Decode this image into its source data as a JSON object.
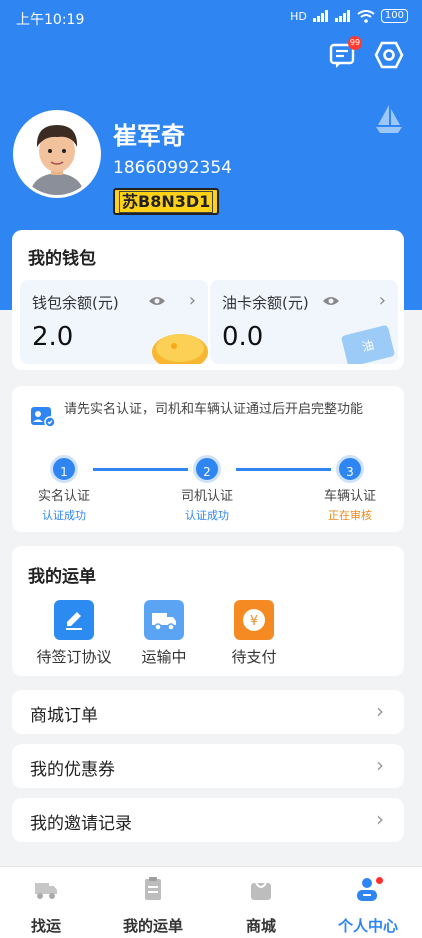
{
  "status_bar": {
    "time": "上午10:19",
    "network": "HD",
    "battery": "100"
  },
  "header": {
    "message_badge": "99"
  },
  "profile": {
    "name": "崔军奇",
    "phone": "18660992354",
    "plate": "苏B8N3D1"
  },
  "wallet": {
    "title": "我的钱包",
    "balance_label": "钱包余额(元)",
    "balance_value": "2.0",
    "oil_label": "油卡余额(元)",
    "oil_value": "0.0",
    "oil_card_text": "油"
  },
  "certification": {
    "notice": "请先实名认证，司机和车辆认证通过后开启完整功能",
    "steps": [
      {
        "number": "1",
        "label": "实名认证",
        "status": "认证成功"
      },
      {
        "number": "2",
        "label": "司机认证",
        "status": "认证成功"
      },
      {
        "number": "3",
        "label": "车辆认证",
        "status": "正在审核"
      }
    ],
    "colors": {
      "success": "#2f86f2",
      "pending": "#f08a18"
    }
  },
  "orders": {
    "title": "我的运单",
    "items": [
      {
        "label": "待签订协议",
        "icon": "pen-icon"
      },
      {
        "label": "运输中",
        "icon": "truck-icon"
      },
      {
        "label": "待支付",
        "icon": "yen-icon"
      }
    ]
  },
  "menu_rows": [
    {
      "label": "商城订单"
    },
    {
      "label": "我的优惠券"
    },
    {
      "label": "我的邀请记录"
    }
  ],
  "tabbar": {
    "tabs": [
      {
        "label": "找运",
        "icon": "truck-icon"
      },
      {
        "label": "我的运单",
        "icon": "clipboard-icon"
      },
      {
        "label": "商城",
        "icon": "shopping-bag-icon"
      },
      {
        "label": "个人中心",
        "icon": "person-icon",
        "active": true
      }
    ]
  },
  "theme": {
    "primary": "#2f86f2",
    "background": "#f2f3f5"
  }
}
